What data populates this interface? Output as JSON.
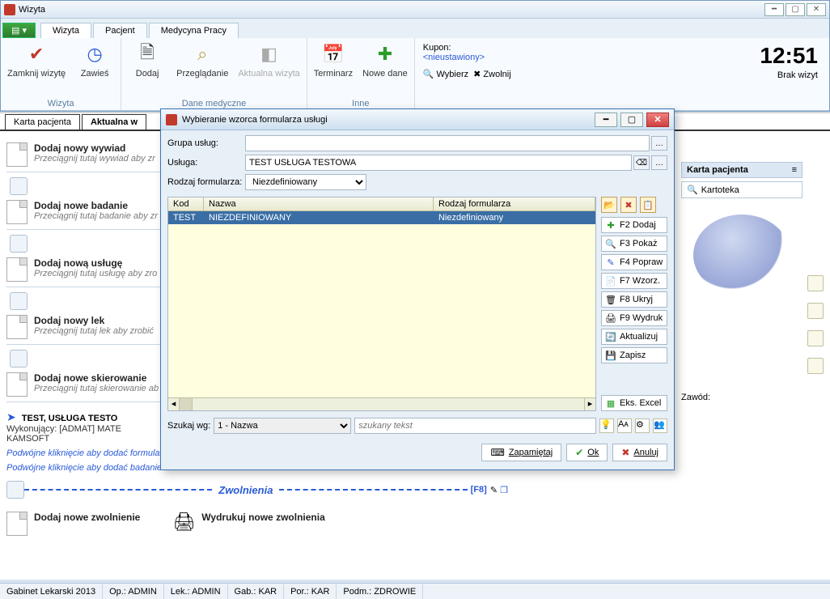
{
  "outer": {
    "title": "Wizyta"
  },
  "tabs": {
    "main": [
      "Wizyta",
      "Pacjent",
      "Medycyna Pracy"
    ],
    "active": 0
  },
  "ribbon": {
    "group1": {
      "label": "Wizyta",
      "close": "Zamknij wizytę",
      "suspend": "Zawieś"
    },
    "group2": {
      "label": "Dane medyczne",
      "add": "Dodaj",
      "browse": "Przeglądanie",
      "current": "Aktualna wizyta"
    },
    "group3": {
      "label": "Inne",
      "terminarz": "Terminarz",
      "nowe": "Nowe dane"
    },
    "kupon": {
      "label": "Kupon:",
      "value": "<nieustawiony>",
      "wybierz": "Wybierz",
      "zwolnij": "Zwolnij",
      "sublabel": "Kupon"
    },
    "clock": {
      "time": "12:51",
      "sub": "Brak wizyt"
    }
  },
  "leftTabs": {
    "a": "Karta pacjenta",
    "b": "Aktualna w"
  },
  "entries": {
    "e1": {
      "title": "Dodaj nowy wywiad",
      "sub": "Przeciągnij tutaj wywiad aby zr"
    },
    "e2": {
      "title": "Dodaj nowe badanie",
      "sub": "Przeciągnij tutaj badanie aby zr"
    },
    "e3": {
      "title": "Dodaj nową usługę",
      "sub": "Przeciągnij tutaj usługę aby zro"
    },
    "e4": {
      "title": "Dodaj nowy lek",
      "sub": "Przeciągnij tutaj lek aby zrobić"
    },
    "e5": {
      "title": "Dodaj nowe skierowanie",
      "sub": "Przeciągnij tutaj skierowanie ab"
    },
    "test": {
      "title": "TEST, USŁUGA TESTO",
      "sub": "Wykonujący: [ADMAT] MATE\nKAMSOFT"
    },
    "dbl1": "Podwójne kliknięcie aby dodać formularz skierowania",
    "dbl2": "Podwójne kliknięcie aby dodać badanie",
    "zwol": "Zwolnienia",
    "f8": "[F8]",
    "e6": {
      "title": "Dodaj nowe zwolnienie"
    },
    "print": "Wydrukuj nowe zwolnienia"
  },
  "rightPanel": {
    "header": "Karta pacjenta",
    "item": "Kartoteka",
    "zawod": "Zawód:"
  },
  "status": {
    "app": "Gabinet Lekarski 2013",
    "op": "Op.: ADMIN",
    "lek": "Lek.: ADMIN",
    "gab": "Gab.: KAR",
    "por": "Por.: KAR",
    "podm": "Podm.: ZDROWIE"
  },
  "dialog": {
    "title": "Wybieranie wzorca formularza usługi",
    "grupa": "Grupa usług:",
    "usluga": "Usługa:",
    "uslugaVal": "TEST USŁUGA TESTOWA",
    "rodzajF": "Rodzaj formularza:",
    "rodzajVal": "Niezdefiniowany",
    "cols": {
      "kod": "Kod",
      "nazwa": "Nazwa",
      "rodzaj": "Rodzaj formularza"
    },
    "row": {
      "kod": "TEST",
      "nazwa": "NIEZDEFINIOWANY",
      "rodzaj": "Niezdefiniowany"
    },
    "side": {
      "f2": "F2 Dodaj",
      "f3": "F3 Pokaż",
      "f4": "F4 Popraw",
      "f7": "F7 Wzorz.",
      "f8": "F8 Ukryj",
      "f9": "F9 Wydruk",
      "aktual": "Aktualizuj",
      "zapisz": "Zapisz",
      "excel": "Eks. Excel"
    },
    "searchLbl": "Szukaj wg:",
    "searchBy": "1 - Nazwa",
    "searchPh": "szukany tekst",
    "zapamietaj": "Zapamiętaj",
    "ok": "Ok",
    "anuluj": "Anuluj"
  }
}
